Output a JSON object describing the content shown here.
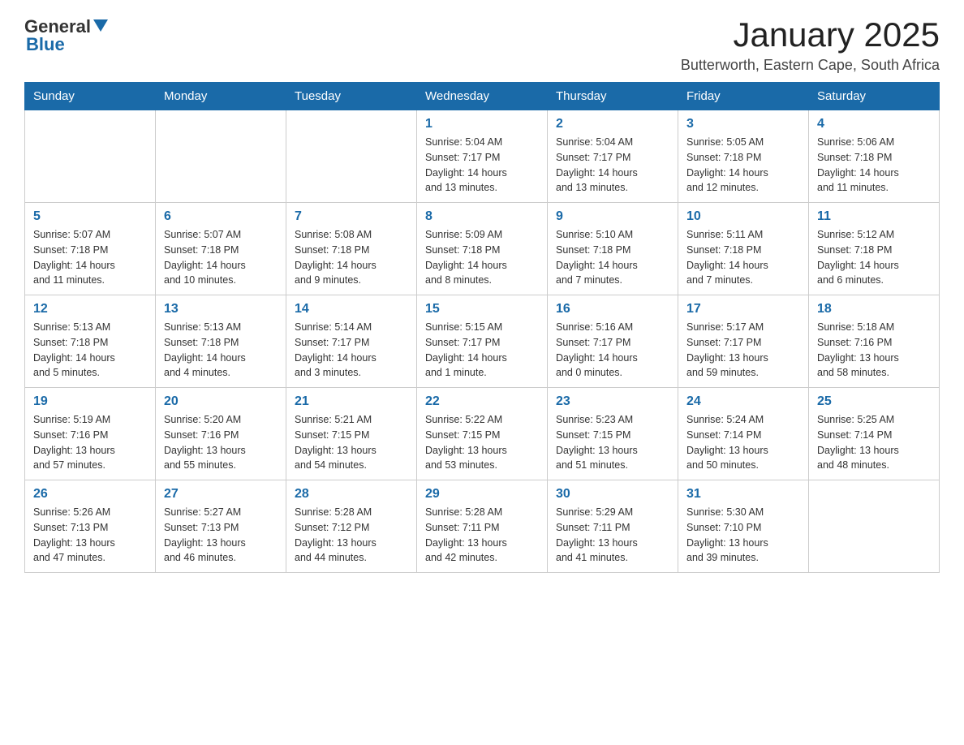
{
  "header": {
    "logo": {
      "general": "General",
      "blue": "Blue"
    },
    "title": "January 2025",
    "location": "Butterworth, Eastern Cape, South Africa"
  },
  "calendar": {
    "weekdays": [
      "Sunday",
      "Monday",
      "Tuesday",
      "Wednesday",
      "Thursday",
      "Friday",
      "Saturday"
    ],
    "weeks": [
      [
        {
          "day": "",
          "info": ""
        },
        {
          "day": "",
          "info": ""
        },
        {
          "day": "",
          "info": ""
        },
        {
          "day": "1",
          "info": "Sunrise: 5:04 AM\nSunset: 7:17 PM\nDaylight: 14 hours\nand 13 minutes."
        },
        {
          "day": "2",
          "info": "Sunrise: 5:04 AM\nSunset: 7:17 PM\nDaylight: 14 hours\nand 13 minutes."
        },
        {
          "day": "3",
          "info": "Sunrise: 5:05 AM\nSunset: 7:18 PM\nDaylight: 14 hours\nand 12 minutes."
        },
        {
          "day": "4",
          "info": "Sunrise: 5:06 AM\nSunset: 7:18 PM\nDaylight: 14 hours\nand 11 minutes."
        }
      ],
      [
        {
          "day": "5",
          "info": "Sunrise: 5:07 AM\nSunset: 7:18 PM\nDaylight: 14 hours\nand 11 minutes."
        },
        {
          "day": "6",
          "info": "Sunrise: 5:07 AM\nSunset: 7:18 PM\nDaylight: 14 hours\nand 10 minutes."
        },
        {
          "day": "7",
          "info": "Sunrise: 5:08 AM\nSunset: 7:18 PM\nDaylight: 14 hours\nand 9 minutes."
        },
        {
          "day": "8",
          "info": "Sunrise: 5:09 AM\nSunset: 7:18 PM\nDaylight: 14 hours\nand 8 minutes."
        },
        {
          "day": "9",
          "info": "Sunrise: 5:10 AM\nSunset: 7:18 PM\nDaylight: 14 hours\nand 7 minutes."
        },
        {
          "day": "10",
          "info": "Sunrise: 5:11 AM\nSunset: 7:18 PM\nDaylight: 14 hours\nand 7 minutes."
        },
        {
          "day": "11",
          "info": "Sunrise: 5:12 AM\nSunset: 7:18 PM\nDaylight: 14 hours\nand 6 minutes."
        }
      ],
      [
        {
          "day": "12",
          "info": "Sunrise: 5:13 AM\nSunset: 7:18 PM\nDaylight: 14 hours\nand 5 minutes."
        },
        {
          "day": "13",
          "info": "Sunrise: 5:13 AM\nSunset: 7:18 PM\nDaylight: 14 hours\nand 4 minutes."
        },
        {
          "day": "14",
          "info": "Sunrise: 5:14 AM\nSunset: 7:17 PM\nDaylight: 14 hours\nand 3 minutes."
        },
        {
          "day": "15",
          "info": "Sunrise: 5:15 AM\nSunset: 7:17 PM\nDaylight: 14 hours\nand 1 minute."
        },
        {
          "day": "16",
          "info": "Sunrise: 5:16 AM\nSunset: 7:17 PM\nDaylight: 14 hours\nand 0 minutes."
        },
        {
          "day": "17",
          "info": "Sunrise: 5:17 AM\nSunset: 7:17 PM\nDaylight: 13 hours\nand 59 minutes."
        },
        {
          "day": "18",
          "info": "Sunrise: 5:18 AM\nSunset: 7:16 PM\nDaylight: 13 hours\nand 58 minutes."
        }
      ],
      [
        {
          "day": "19",
          "info": "Sunrise: 5:19 AM\nSunset: 7:16 PM\nDaylight: 13 hours\nand 57 minutes."
        },
        {
          "day": "20",
          "info": "Sunrise: 5:20 AM\nSunset: 7:16 PM\nDaylight: 13 hours\nand 55 minutes."
        },
        {
          "day": "21",
          "info": "Sunrise: 5:21 AM\nSunset: 7:15 PM\nDaylight: 13 hours\nand 54 minutes."
        },
        {
          "day": "22",
          "info": "Sunrise: 5:22 AM\nSunset: 7:15 PM\nDaylight: 13 hours\nand 53 minutes."
        },
        {
          "day": "23",
          "info": "Sunrise: 5:23 AM\nSunset: 7:15 PM\nDaylight: 13 hours\nand 51 minutes."
        },
        {
          "day": "24",
          "info": "Sunrise: 5:24 AM\nSunset: 7:14 PM\nDaylight: 13 hours\nand 50 minutes."
        },
        {
          "day": "25",
          "info": "Sunrise: 5:25 AM\nSunset: 7:14 PM\nDaylight: 13 hours\nand 48 minutes."
        }
      ],
      [
        {
          "day": "26",
          "info": "Sunrise: 5:26 AM\nSunset: 7:13 PM\nDaylight: 13 hours\nand 47 minutes."
        },
        {
          "day": "27",
          "info": "Sunrise: 5:27 AM\nSunset: 7:13 PM\nDaylight: 13 hours\nand 46 minutes."
        },
        {
          "day": "28",
          "info": "Sunrise: 5:28 AM\nSunset: 7:12 PM\nDaylight: 13 hours\nand 44 minutes."
        },
        {
          "day": "29",
          "info": "Sunrise: 5:28 AM\nSunset: 7:11 PM\nDaylight: 13 hours\nand 42 minutes."
        },
        {
          "day": "30",
          "info": "Sunrise: 5:29 AM\nSunset: 7:11 PM\nDaylight: 13 hours\nand 41 minutes."
        },
        {
          "day": "31",
          "info": "Sunrise: 5:30 AM\nSunset: 7:10 PM\nDaylight: 13 hours\nand 39 minutes."
        },
        {
          "day": "",
          "info": ""
        }
      ]
    ]
  }
}
